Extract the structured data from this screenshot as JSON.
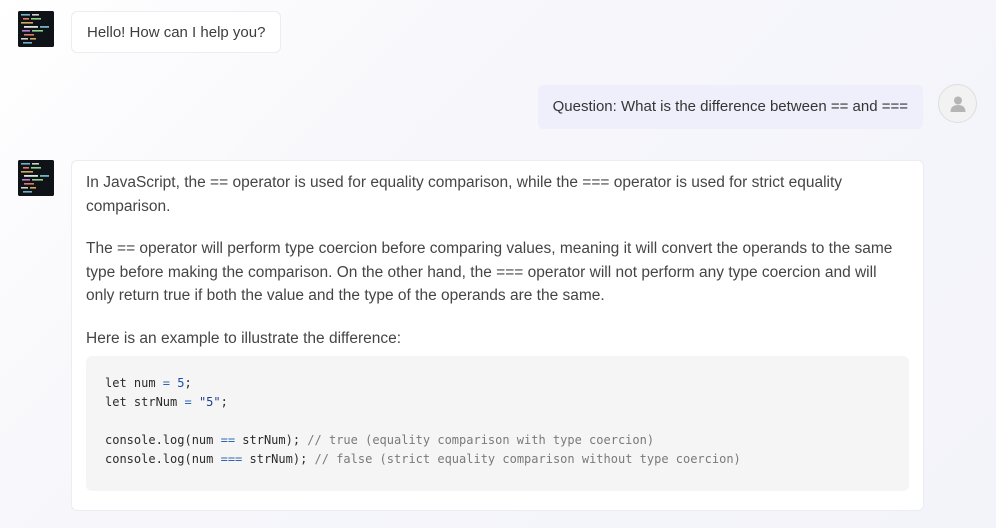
{
  "conversation": {
    "greeting": "Hello! How can I help you?",
    "user_question": "Question: What is the difference between == and ===",
    "answer": {
      "paragraph_1": "In JavaScript, the == operator is used for equality comparison, while the === operator is used for strict equality comparison.",
      "paragraph_2": "The == operator will perform type coercion before comparing values, meaning it will convert the operands to the same type before making the comparison. On the other hand, the === operator will not perform any type coercion and will only return true if both the value and the type of the operands are the same.",
      "paragraph_3": "Here is an example to illustrate the difference:",
      "code": {
        "line1": {
          "kw": "let num ",
          "op": "=",
          "sp": " ",
          "val": "5",
          "end": ";"
        },
        "line2": {
          "kw": "let strNum ",
          "op": "=",
          "sp": " ",
          "val": "\"5\"",
          "end": ";"
        },
        "line4": {
          "pre": "console.log(num ",
          "op": "==",
          "post": " strNum); ",
          "comment": "// true (equality comparison with type coercion)"
        },
        "line5": {
          "pre": "console.log(num ",
          "op": "===",
          "post": " strNum); ",
          "comment": "// false (strict equality comparison without type coercion)"
        }
      }
    }
  },
  "icons": {
    "bot_avatar": "code-screen-avatar-icon",
    "user_avatar": "user-silhouette-icon"
  },
  "colors": {
    "user_bubble": "#eeeffa",
    "bot_bubble": "#ffffff",
    "code_background": "#f5f5f6"
  }
}
